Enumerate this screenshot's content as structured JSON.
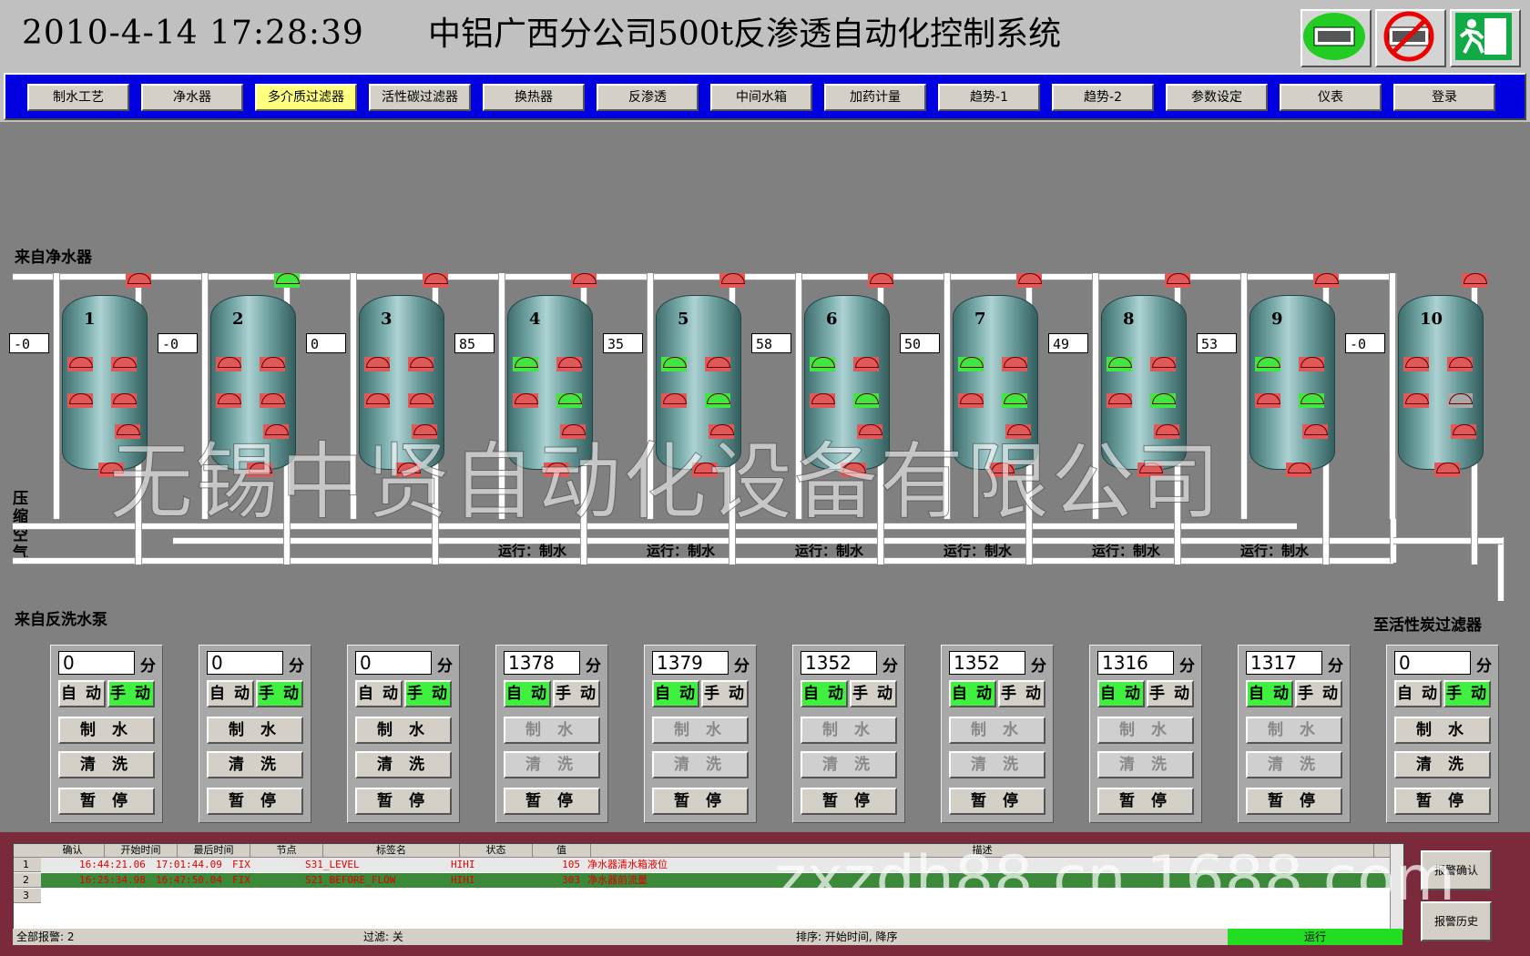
{
  "header": {
    "datetime": "2010-4-14  17:28:39",
    "title": "中铝广西分公司500t反渗透自动化控制系统"
  },
  "nav": [
    "制水工艺",
    "净水器",
    "多介质过滤器",
    "活性碳过滤器",
    "换热器",
    "反渗透",
    "中间水箱",
    "加药计量",
    "趋势-1",
    "趋势-2",
    "参数设定",
    "仪表",
    "登录"
  ],
  "nav_active": "多介质过滤器",
  "labels": {
    "from_clarifier": "来自净水器",
    "compressed_air": "压缩空气",
    "from_backwash": "来自反洗水泵",
    "to_carbon": "至活性炭过滤器"
  },
  "watermark": "无锡中贤自动化设备有限公司",
  "watermark2": "zxzdh88.cn.1688.com",
  "filters": [
    {
      "num": "1",
      "reading": "-0",
      "timer": "0",
      "unit": "分",
      "mode_auto": "自 动",
      "mode_manual": "手 动",
      "mode": "manual",
      "run_text": "",
      "btn_make": "制 水",
      "btn_wash": "清 洗",
      "btn_pause": "暂 停"
    },
    {
      "num": "2",
      "reading": "-0",
      "timer": "0",
      "unit": "分",
      "mode_auto": "自 动",
      "mode_manual": "手 动",
      "mode": "manual",
      "run_text": "",
      "btn_make": "制 水",
      "btn_wash": "清 洗",
      "btn_pause": "暂 停"
    },
    {
      "num": "3",
      "reading": "0",
      "timer": "0",
      "unit": "分",
      "mode_auto": "自 动",
      "mode_manual": "手 动",
      "mode": "manual",
      "run_text": "",
      "btn_make": "制 水",
      "btn_wash": "清 洗",
      "btn_pause": "暂 停"
    },
    {
      "num": "4",
      "reading": "85",
      "timer": "1378",
      "unit": "分",
      "mode_auto": "自 动",
      "mode_manual": "手 动",
      "mode": "auto",
      "run_text": "运行：制水",
      "btn_make": "制 水",
      "btn_wash": "清 洗",
      "btn_pause": "暂 停"
    },
    {
      "num": "5",
      "reading": "35",
      "timer": "1379",
      "unit": "分",
      "mode_auto": "自 动",
      "mode_manual": "手 动",
      "mode": "auto",
      "run_text": "运行：制水",
      "btn_make": "制 水",
      "btn_wash": "清 洗",
      "btn_pause": "暂 停"
    },
    {
      "num": "6",
      "reading": "58",
      "timer": "1352",
      "unit": "分",
      "mode_auto": "自 动",
      "mode_manual": "手 动",
      "mode": "auto",
      "run_text": "运行：制水",
      "btn_make": "制 水",
      "btn_wash": "清 洗",
      "btn_pause": "暂 停"
    },
    {
      "num": "7",
      "reading": "50",
      "timer": "1352",
      "unit": "分",
      "mode_auto": "自 动",
      "mode_manual": "手 动",
      "mode": "auto",
      "run_text": "运行：制水",
      "btn_make": "制 水",
      "btn_wash": "清 洗",
      "btn_pause": "暂 停"
    },
    {
      "num": "8",
      "reading": "49",
      "timer": "1316",
      "unit": "分",
      "mode_auto": "自 动",
      "mode_manual": "手 动",
      "mode": "auto",
      "run_text": "运行：制水",
      "btn_make": "制 水",
      "btn_wash": "清 洗",
      "btn_pause": "暂 停"
    },
    {
      "num": "9",
      "reading": "53",
      "timer": "1317",
      "unit": "分",
      "mode_auto": "自 动",
      "mode_manual": "手 动",
      "mode": "auto",
      "run_text": "运行：制水",
      "btn_make": "制 水",
      "btn_wash": "清 洗",
      "btn_pause": "暂 停"
    },
    {
      "num": "10",
      "reading": "-0",
      "timer": "0",
      "unit": "分",
      "mode_auto": "自 动",
      "mode_manual": "手 动",
      "mode": "manual",
      "run_text": "",
      "btn_make": "制 水",
      "btn_wash": "清 洗",
      "btn_pause": "暂 停"
    }
  ],
  "colors": {
    "valve_open": "#3fe83f",
    "valve_closed": "#e05858",
    "nav_bg": "#0000e0",
    "alarm_bg": "#7b2a3c",
    "run_green": "#22dd22"
  },
  "alarm": {
    "columns": [
      "确认",
      "开始时间",
      "最后时间",
      "节点",
      "标签名",
      "状态",
      "值",
      "描述"
    ],
    "rows": [
      {
        "num": "1",
        "start": "16:44:21.06",
        "last": "17:01:44.09",
        "node": "FIX",
        "tag": "S31_LEVEL",
        "state": "HIHI",
        "value": "105",
        "desc": "净水器清水箱液位"
      },
      {
        "num": "2",
        "start": "16:25:34.98",
        "last": "16:47:50.04",
        "node": "FIX",
        "tag": "S21_BEFORE_FLOW",
        "state": "HIHI",
        "value": "303",
        "desc": "净水器前流量"
      },
      {
        "num": "3",
        "start": "",
        "last": "",
        "node": "",
        "tag": "",
        "state": "",
        "value": "",
        "desc": ""
      }
    ],
    "btn_ack": "报警确认",
    "btn_history": "报警历史",
    "status_total": "全部报警: 2",
    "status_filter": "过滤: 关",
    "status_sort": "排序: 开始时间, 降序",
    "status_run": "运行"
  }
}
